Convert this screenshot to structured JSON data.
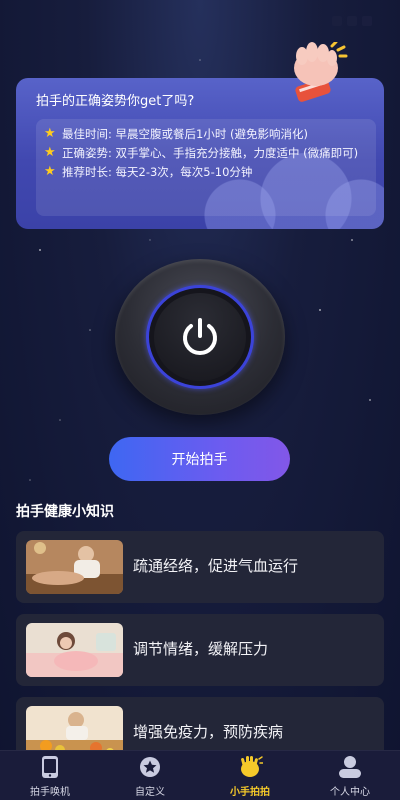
{
  "status_bar": {
    "time": ""
  },
  "tip_card": {
    "title": "拍手的正确姿势你get了吗?",
    "items": [
      {
        "icon": "star-icon",
        "text": "最佳时间: 早晨空腹或餐后1小时 (避免影响消化)"
      },
      {
        "icon": "star-icon",
        "text": "正确姿势: 双手掌心、手指充分接触，力度适中 (微痛即可)"
      },
      {
        "icon": "star-icon",
        "text": "推荐时长: 每天2-3次，每次5-10分钟"
      }
    ]
  },
  "power_button": {
    "icon": "power-icon"
  },
  "start_button": {
    "label": "开始拍手"
  },
  "knowledge": {
    "title": "拍手健康小知识",
    "items": [
      {
        "label": "疏通经络，促进气血运行"
      },
      {
        "label": "调节情绪，缓解压力"
      },
      {
        "label": "增强免疫力，预防疾病"
      }
    ]
  },
  "tabbar": {
    "tabs": [
      {
        "label": "拍手唤机",
        "icon": "phone-icon",
        "active": false
      },
      {
        "label": "自定义",
        "icon": "star-badge-icon",
        "active": false
      },
      {
        "label": "小手拍拍",
        "icon": "clapping-hands-icon",
        "active": true
      },
      {
        "label": "个人中心",
        "icon": "user-icon",
        "active": false
      }
    ]
  },
  "colors": {
    "accent_yellow": "#f5c92a",
    "button_gradient_start": "#3e67f2",
    "button_gradient_end": "#8257e8",
    "card_bg": "#232638",
    "tip_card_bg": "#4a52bd"
  }
}
